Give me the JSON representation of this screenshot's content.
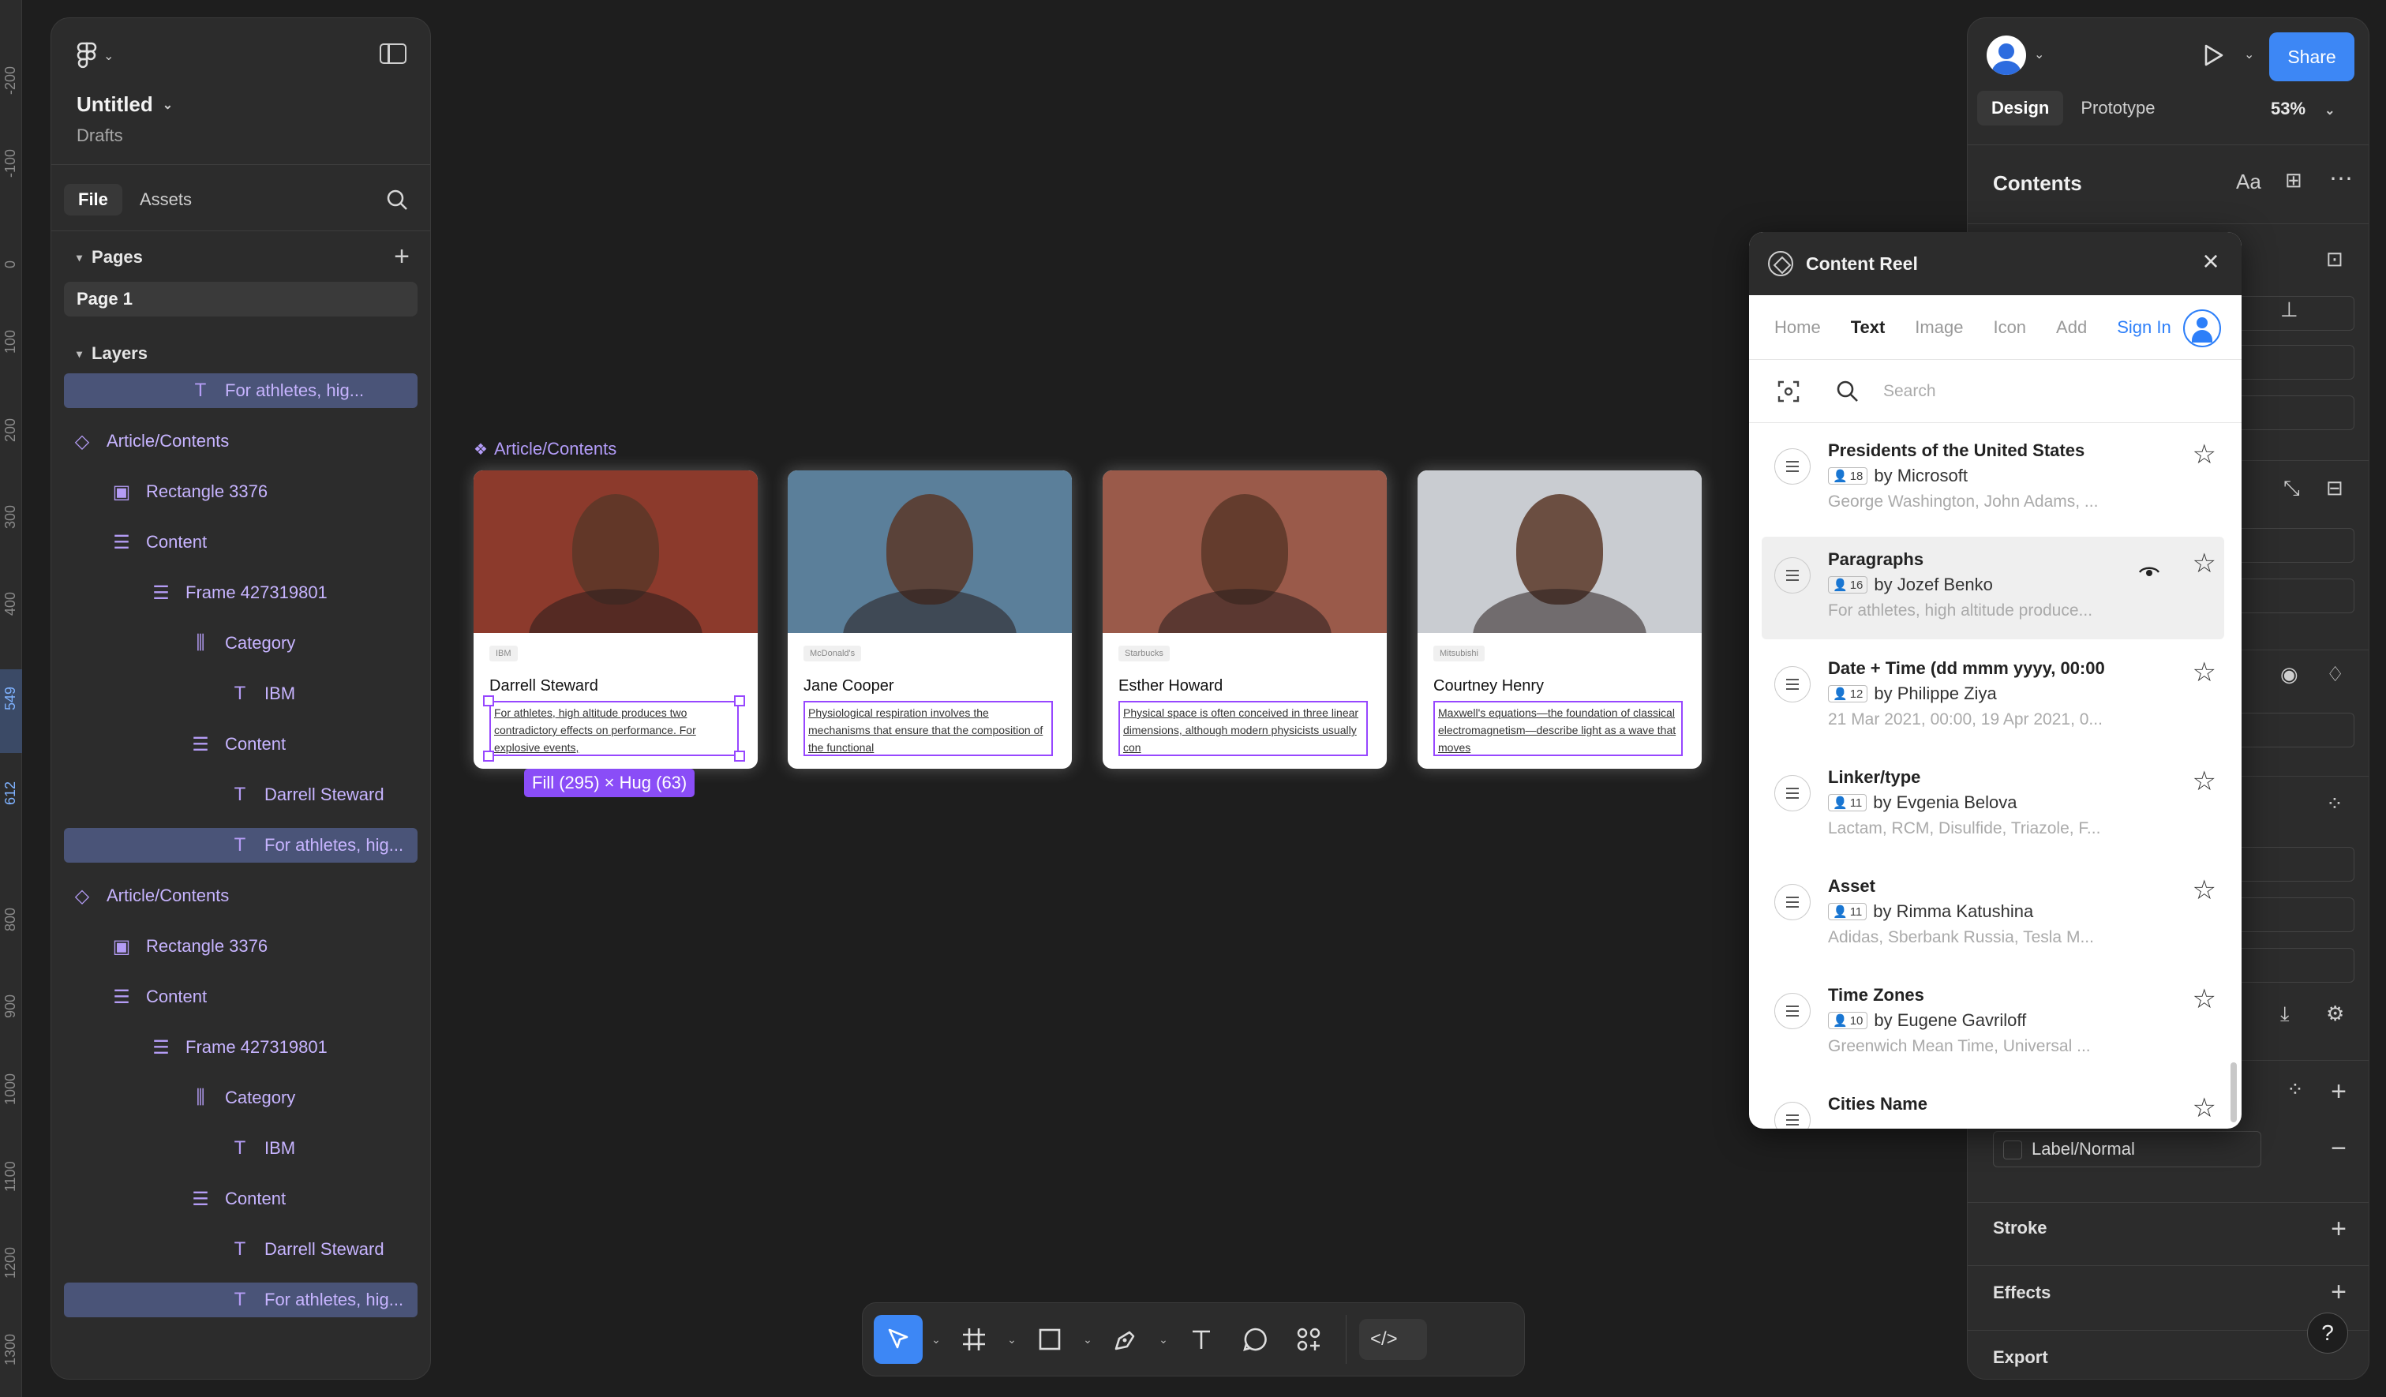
{
  "ruler": {
    "ticks": [
      "-200",
      "-100",
      "0",
      "100",
      "200",
      "300",
      "400",
      "549",
      "612",
      "800",
      "900",
      "1000",
      "1100",
      "1200",
      "1300"
    ],
    "selected": [
      "549",
      "612"
    ]
  },
  "left": {
    "file_title": "Untitled",
    "file_sub": "Drafts",
    "tab_file": "File",
    "tab_assets": "Assets",
    "pages_label": "Pages",
    "page_1": "Page 1",
    "layers_label": "Layers",
    "layers": [
      {
        "label": "For athletes, hig...",
        "icon": "text-icon",
        "indent": 3,
        "selected": true
      },
      {
        "label": "Article/Contents",
        "icon": "component-icon",
        "indent": 0
      },
      {
        "label": "Rectangle 3376",
        "icon": "image-icon",
        "indent": 1
      },
      {
        "label": "Content",
        "icon": "stack-icon",
        "indent": 1
      },
      {
        "label": "Frame 427319801",
        "icon": "stack-icon",
        "indent": 2
      },
      {
        "label": "Category",
        "icon": "columns-icon",
        "indent": 3
      },
      {
        "label": "IBM",
        "icon": "text-icon",
        "indent": 4
      },
      {
        "label": "Content",
        "icon": "stack-icon",
        "indent": 3
      },
      {
        "label": "Darrell Steward",
        "icon": "text-icon",
        "indent": 4
      },
      {
        "label": "For athletes, hig...",
        "icon": "text-icon",
        "indent": 4,
        "selected": true
      },
      {
        "label": "Article/Contents",
        "icon": "component-icon",
        "indent": 0
      },
      {
        "label": "Rectangle 3376",
        "icon": "image-icon",
        "indent": 1
      },
      {
        "label": "Content",
        "icon": "stack-icon",
        "indent": 1
      },
      {
        "label": "Frame 427319801",
        "icon": "stack-icon",
        "indent": 2
      },
      {
        "label": "Category",
        "icon": "columns-icon",
        "indent": 3
      },
      {
        "label": "IBM",
        "icon": "text-icon",
        "indent": 4
      },
      {
        "label": "Content",
        "icon": "stack-icon",
        "indent": 3
      },
      {
        "label": "Darrell Steward",
        "icon": "text-icon",
        "indent": 4
      },
      {
        "label": "For athletes, hig...",
        "icon": "text-icon",
        "indent": 4,
        "selected": true
      }
    ]
  },
  "canvas": {
    "frame_label": "Article/Contents",
    "fill_badge": "Fill (295) × Hug (63)",
    "cards": [
      {
        "tag": "IBM",
        "name": "Darrell Steward",
        "desc": "For athletes, high altitude produces two contradictory effects on performance. For explosive events,",
        "bg": "#8c3a2c"
      },
      {
        "tag": "McDonald's",
        "name": "Jane Cooper",
        "desc": "Physiological respiration involves the mechanisms that ensure that the composition of the functional",
        "bg": "#5b7f9a"
      },
      {
        "tag": "Starbucks",
        "name": "Esther Howard",
        "desc": "Physical space is often conceived in three linear dimensions, although modern physicists usually con",
        "bg": "#9a5a4a"
      },
      {
        "tag": "Mitsubishi",
        "name": "Courtney Henry",
        "desc": "Maxwell's equations—the foundation of classical electromagnetism—describe light as a wave that moves",
        "bg": "#c9ccd1"
      }
    ]
  },
  "right": {
    "share": "Share",
    "tab_design": "Design",
    "tab_prototype": "Prototype",
    "zoom": "53%",
    "contents_heading": "Contents",
    "label_normal": "Label/Normal",
    "stroke": "Stroke",
    "effects": "Effects",
    "export": "Export",
    "help": "?"
  },
  "reel": {
    "title": "Content Reel",
    "nav": [
      "Home",
      "Text",
      "Image",
      "Icon",
      "Add"
    ],
    "sign_in": "Sign In",
    "search_placeholder": "Search",
    "items": [
      {
        "title": "Presidents of the United States",
        "count": "18",
        "author": "by Microsoft",
        "preview": "George Washington, John Adams, ..."
      },
      {
        "title": "Paragraphs",
        "count": "16",
        "author": "by Jozef Benko",
        "preview": "For athletes, high altitude produce...",
        "hover": true
      },
      {
        "title": "Date + Time (dd mmm yyyy, 00:00",
        "count": "12",
        "author": "by Philippe Ziya",
        "preview": "21 Mar 2021, 00:00, 19 Apr 2021, 0..."
      },
      {
        "title": "Linker/type",
        "count": "11",
        "author": "by Evgenia Belova",
        "preview": "Lactam, RCM, Disulfide, Triazole, F..."
      },
      {
        "title": "Asset",
        "count": "11",
        "author": "by Rimma Katushina",
        "preview": "Adidas, Sberbank Russia, Tesla M..."
      },
      {
        "title": "Time Zones",
        "count": "10",
        "author": "by Eugene Gavriloff",
        "preview": "Greenwich Mean Time, Universal ..."
      },
      {
        "title": "Cities Name",
        "count": "",
        "author": "",
        "preview": ""
      }
    ]
  },
  "colors": {
    "accent": "#3d87f5",
    "selection": "#9747ff",
    "layer_text": "#c7b4ff"
  }
}
